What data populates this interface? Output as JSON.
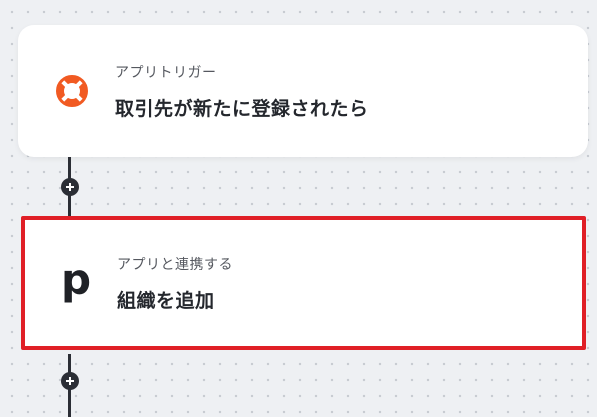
{
  "flow": {
    "trigger": {
      "subtitle": "アプリトリガー",
      "title": "取引先が新たに登録されたら",
      "icon": "lifebuoy-icon",
      "icon_color": "#f15a22"
    },
    "action": {
      "subtitle": "アプリと連携する",
      "title": "組織を追加",
      "icon": "pipedrive-p-logo",
      "icon_text": "p",
      "highlight_color": "#e01f26"
    },
    "add_step_icon": "plus-icon"
  }
}
